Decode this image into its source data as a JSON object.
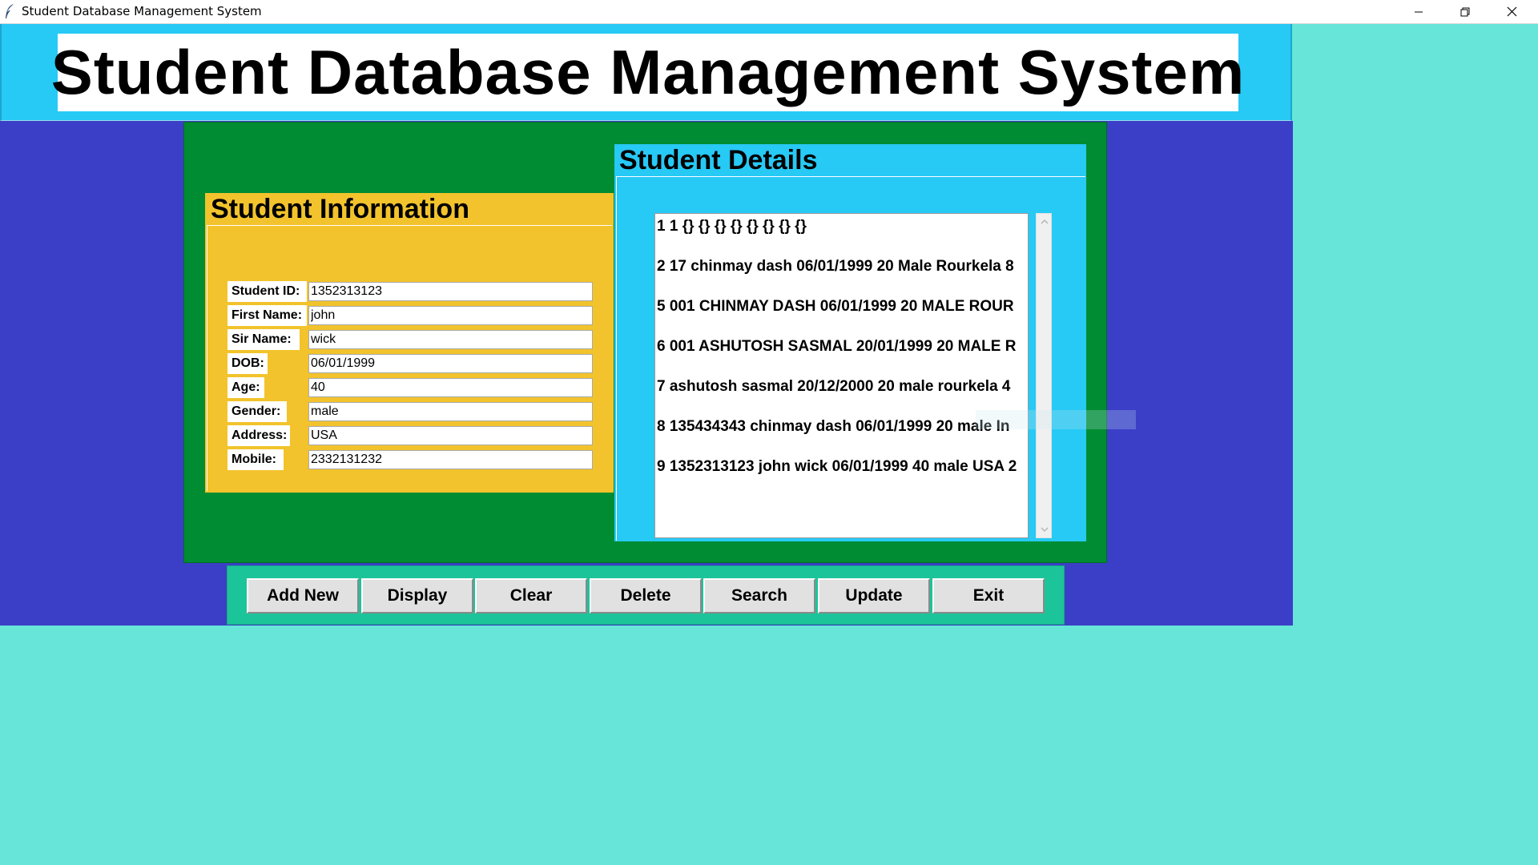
{
  "window": {
    "title": "Student Database Management System",
    "controls": {
      "minimize": "minimize",
      "maximize": "restore",
      "close": "close"
    }
  },
  "header": {
    "title": "Student Database Management System"
  },
  "info_panel": {
    "title": "Student Information",
    "fields": [
      {
        "label": "Student ID:",
        "value": "1352313123"
      },
      {
        "label": "First Name:",
        "value": "john"
      },
      {
        "label": "Sir Name:",
        "value": "wick"
      },
      {
        "label": "DOB:",
        "value": "06/01/1999"
      },
      {
        "label": "Age:",
        "value": "40"
      },
      {
        "label": "Gender:",
        "value": "male"
      },
      {
        "label": "Address:",
        "value": "USA"
      },
      {
        "label": "Mobile:",
        "value": "2332131232"
      }
    ]
  },
  "details_panel": {
    "title": "Student Details",
    "records": [
      "1 1 {} {} {} {} {} {} {} {}",
      "2 17 chinmay dash 06/01/1999 20 Male Rourkela 8",
      "5 001 CHINMAY DASH 06/01/1999 20 MALE ROUR",
      "6 001 ASHUTOSH SASMAL 20/01/1999 20 MALE R",
      "7 ashutosh sasmal 20/12/2000 20 male rourkela 4",
      "8 135434343 chinmay dash 06/01/1999 20 male In",
      "9 1352313123 john wick 06/01/1999 40 male USA 2"
    ]
  },
  "buttons": {
    "add_new": "Add New",
    "display": "Display",
    "clear": "Clear",
    "delete": "Delete",
    "search": "Search",
    "update": "Update",
    "exit": "Exit"
  },
  "colors": {
    "background": "#67e5d9",
    "header": "#27c9f5",
    "main_blue": "#3b3fc7",
    "green_panel": "#008c32",
    "info_panel": "#f2c32c",
    "details_panel": "#27c9f5",
    "button_bar": "#1cc49a",
    "button": "#e1e1e1"
  },
  "icons": {
    "app": "feather-icon",
    "minimize": "minimize-icon",
    "maximize": "restore-icon",
    "close": "close-icon",
    "scroll_up": "chevron-up-icon",
    "scroll_down": "chevron-down-icon"
  }
}
